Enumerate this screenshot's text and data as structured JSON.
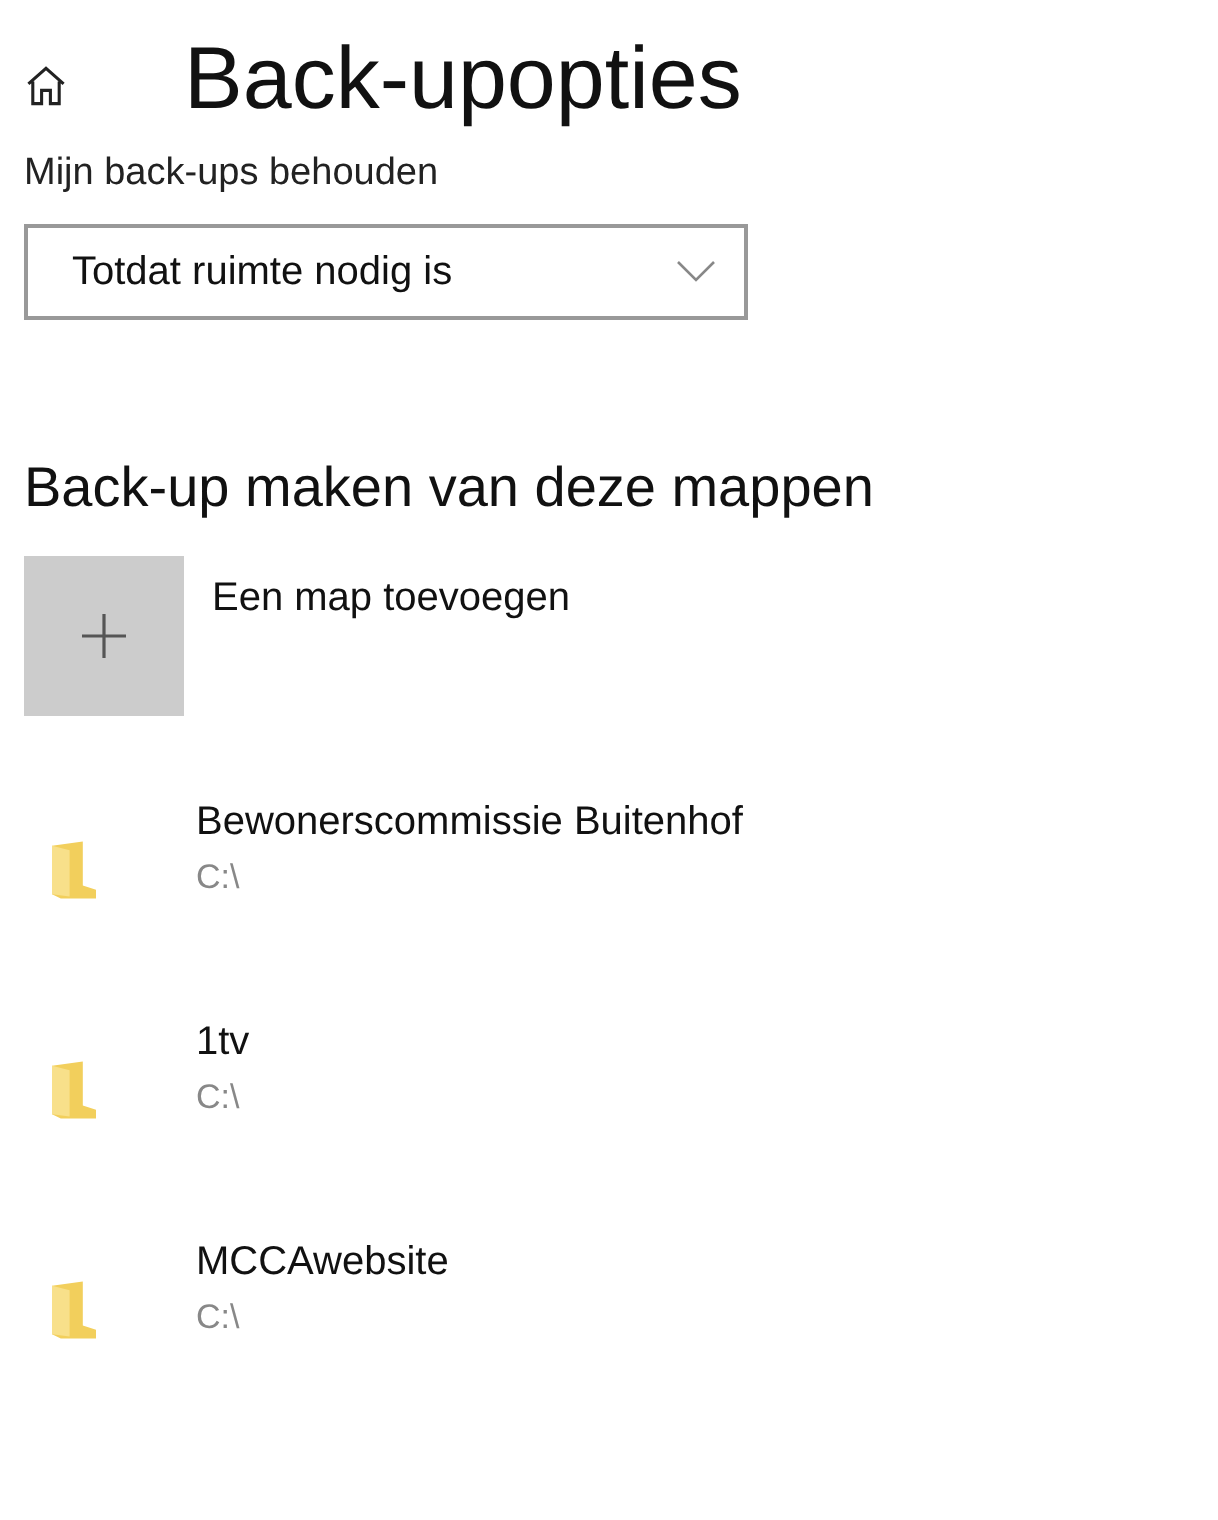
{
  "title": "Back-upopties",
  "retention": {
    "label": "Mijn back-ups behouden",
    "value": "Totdat ruimte nodig is"
  },
  "folders_section": {
    "heading": "Back-up maken van deze mappen",
    "add_label": "Een map toevoegen",
    "folders": [
      {
        "name": "Bewonerscommissie Buitenhof",
        "path": "C:\\"
      },
      {
        "name": "1tv",
        "path": "C:\\"
      },
      {
        "name": "MCCAwebsite",
        "path": "C:\\"
      }
    ]
  }
}
